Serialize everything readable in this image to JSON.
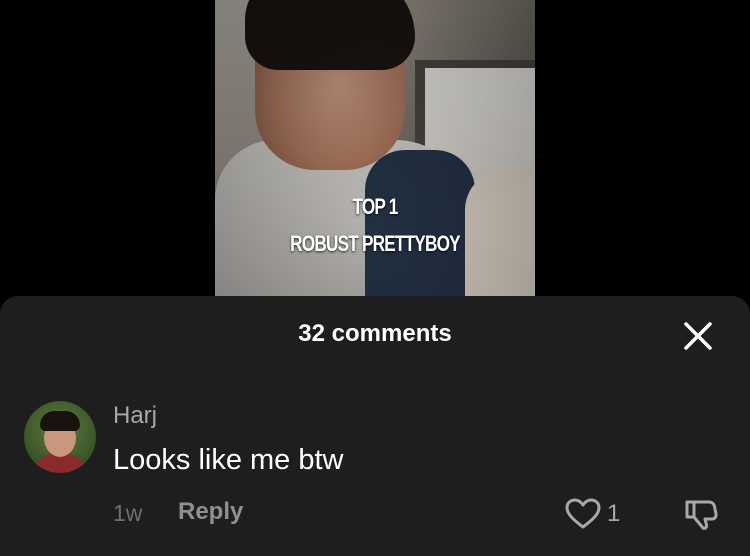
{
  "video": {
    "overlay_line1": "TOP 1",
    "overlay_line2": "ROBUST PRETTYBOY"
  },
  "comments_sheet": {
    "title": "32 comments",
    "close_icon": "close-icon"
  },
  "comment": {
    "username": "Harj",
    "text": "Looks like me btw",
    "time": "1w",
    "reply_label": "Reply",
    "like_count": "1",
    "like_icon": "heart-outline-icon",
    "dislike_icon": "thumbs-down-icon"
  },
  "colors": {
    "sheet_background": "#1e1e1e",
    "page_background": "#000000",
    "secondary_text": "#a8a8a8"
  }
}
